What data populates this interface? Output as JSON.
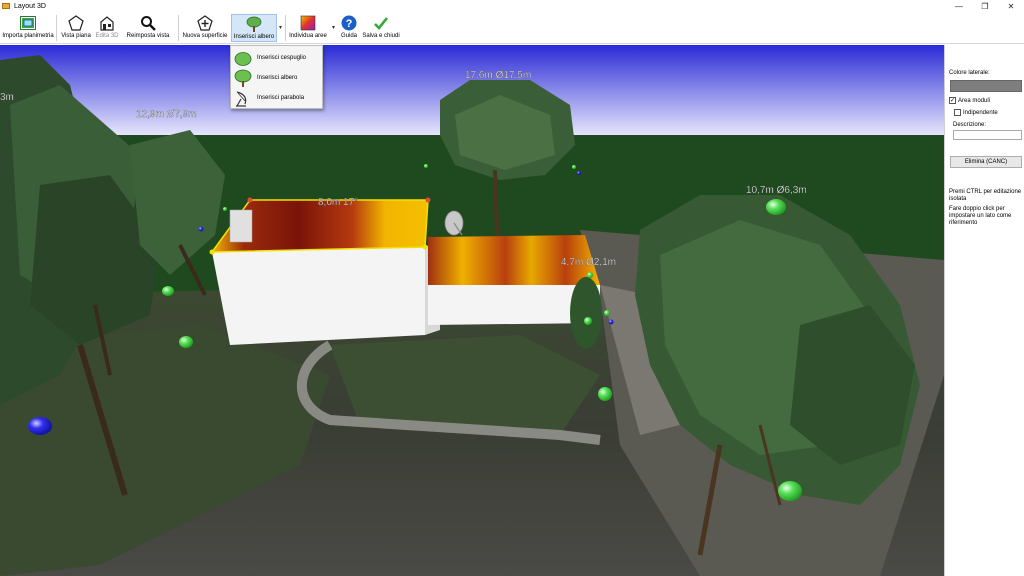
{
  "window": {
    "title": "Layout 3D",
    "minimize_glyph": "—",
    "maximize_glyph": "❐",
    "close_glyph": "✕"
  },
  "toolbar": {
    "items": [
      {
        "id": "importa",
        "label": "Importa planimetria",
        "icon": "floorplan-image-icon"
      },
      {
        "id": "vista-piana",
        "label": "Vista piana",
        "icon": "pentagon-outline-icon"
      },
      {
        "id": "edita-3d",
        "label": "Edita 3D",
        "icon": "house-3d-icon",
        "disabled": true
      },
      {
        "id": "reimposta",
        "label": "Reimposta vista",
        "icon": "magnifier-icon"
      },
      {
        "id": "nuova-superficie",
        "label": "Nuova superficie",
        "icon": "add-surface-icon"
      },
      {
        "id": "inserisci-albero",
        "label": "Inserisci albero",
        "icon": "tree-icon",
        "pressed": true
      },
      {
        "id": "individua-aree",
        "label": "Individua aree",
        "icon": "gradient-area-icon"
      },
      {
        "id": "guida",
        "label": "Guida",
        "icon": "help-icon"
      },
      {
        "id": "salva",
        "label": "Salva e chiudi",
        "icon": "checkmark-icon"
      }
    ]
  },
  "dropdown_menu": {
    "items": [
      {
        "label": "Inserisci cespuglio",
        "icon": "bush-icon"
      },
      {
        "label": "Inserisci albero",
        "icon": "tree-icon"
      },
      {
        "label": "Inserisci parabola",
        "icon": "satellite-dish-icon"
      }
    ]
  },
  "scene": {
    "labels": [
      {
        "id": "left-edge",
        "text": "3m"
      },
      {
        "id": "tree-left",
        "text": "12,9m Ø7,9m"
      },
      {
        "id": "tree-center",
        "text": "17,6m Ø17,5m"
      },
      {
        "id": "roof-main",
        "text": "8,0m  17°"
      },
      {
        "id": "roof-annex",
        "text": "4,7m Ø2,1m"
      },
      {
        "id": "tree-right",
        "text": "10,7m Ø6,3m"
      }
    ],
    "colors": {
      "sky_top": "#2b2bd6",
      "sky_bottom": "#f0f0ff",
      "hedge": "#1f4a1f",
      "tree": "#3f6b3b",
      "roof_hot": "#8b1a0a",
      "roof_warm": "#f2b400",
      "wall": "#f4f4f4",
      "handle_green": "#3ad23a",
      "handle_blue": "#1f1fe0"
    }
  },
  "side_panel": {
    "colore_laterale_label": "Colore laterale:",
    "colore_laterale_value": "#7e7e7e",
    "area_moduli_label": "Area moduli",
    "area_moduli_checked": true,
    "indipendente_label": "Indipendente",
    "indipendente_checked": false,
    "descrizione_label": "Descrizione:",
    "descrizione_value": "",
    "elimina_label": "Elimina (CANC)",
    "hint1": "Premi CTRL per editazione isolata",
    "hint2": "Fare doppio click per impostare un lato come riferimento"
  }
}
